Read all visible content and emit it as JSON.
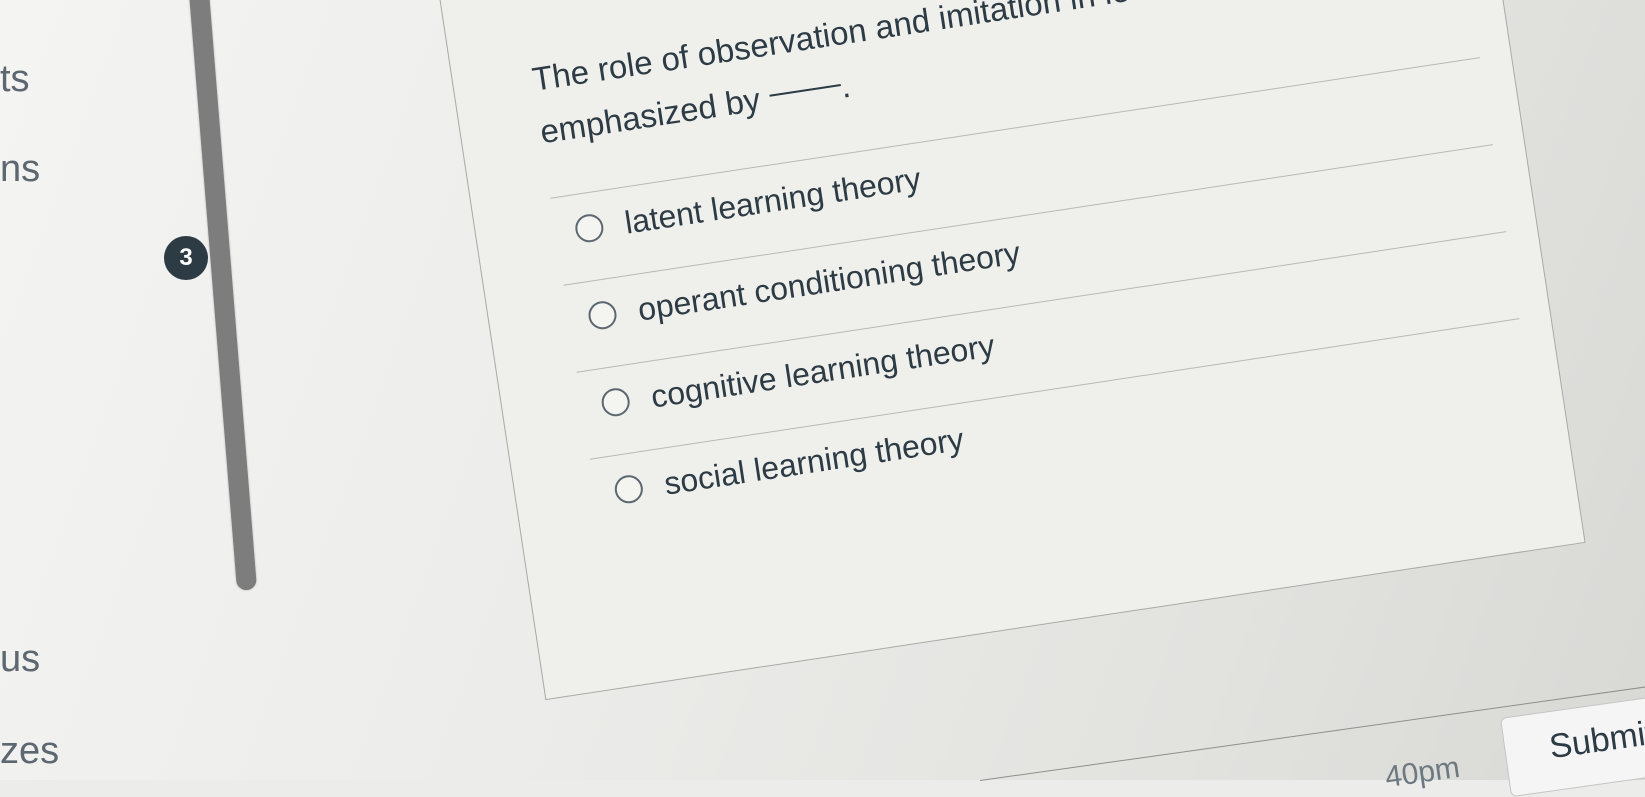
{
  "sidebar": {
    "fragments": [
      "ts",
      "ns",
      "us",
      "zes"
    ]
  },
  "question": {
    "number": "3",
    "text_line1": "The role of observation and imitation in learning is",
    "text_line2": "emphasized by",
    "blank_suffix": ".",
    "options": [
      "latent learning theory",
      "operant conditioning theory",
      "cognitive learning theory",
      "social learning theory"
    ]
  },
  "footer": {
    "time_fragment": "40pm",
    "submit_label": "Submit"
  },
  "colors": {
    "text": "#2d3b45",
    "badge_bg": "#2d3b45",
    "rail": "#7d7d7d"
  }
}
